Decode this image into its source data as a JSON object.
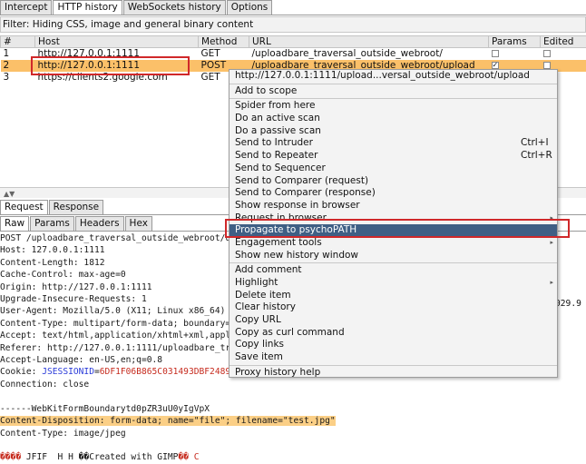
{
  "top_tabs": [
    "Intercept",
    "HTTP history",
    "WebSockets history",
    "Options"
  ],
  "filter_text": "Filter: Hiding CSS, image and general binary content",
  "columns": [
    "#",
    "Host",
    "Method",
    "URL",
    "Params",
    "Edited"
  ],
  "rows": [
    {
      "num": "1",
      "host": "http://127.0.0.1:1111",
      "method": "GET",
      "url": "/uploadbare_traversal_outside_webroot/",
      "params": false
    },
    {
      "num": "2",
      "host": "http://127.0.0.1:1111",
      "method": "POST",
      "url": "/uploadbare_traversal_outside_webroot/upload",
      "params": true
    },
    {
      "num": "3",
      "host": "https://clients2.google.com",
      "method": "GET",
      "url": "",
      "params": false
    }
  ],
  "req_tabs": [
    "Request",
    "Response"
  ],
  "sub_tabs": [
    "Raw",
    "Params",
    "Headers",
    "Hex"
  ],
  "request_lines": [
    "POST /uploadbare_traversal_outside_webroot/u",
    "Host: 127.0.0.1:1111",
    "Content-Length: 1812",
    "Cache-Control: max-age=0",
    "Origin: http://127.0.0.1:1111",
    "Upgrade-Insecure-Requests: 1",
    "User-Agent: Mozilla/5.0 (X11; Linux x86_64)",
    "Content-Type: multipart/form-data; boundary=",
    "Accept: text/html,application/xhtml+xml,appl",
    "Referer: http://127.0.0.1:1111/uploadbare_tr",
    "Accept-Language: en-US,en;q=0.8"
  ],
  "cookie_prefix": "Cookie: ",
  "cookie_name": "JSESSIONID",
  "cookie_eq": "=",
  "cookie_value": "6DF1F06B865C031493DBF2489",
  "connection_line": "Connection: close",
  "boundary_line": "------WebKitFormBoundarytd0pZR3uU0yIgVpX",
  "disposition_line": "Content-Disposition: form-data; name=\"file\"; filename=\"test.jpg\"",
  "content_type_line": "Content-Type: image/jpeg",
  "binary_prefix": "���� ",
  "binary_text": "JFIF  H H ��Created with GIMP",
  "binary_suffix": "�� C",
  "ua_cut_text": "029.9",
  "context_menu": {
    "header": "http://127.0.0.1:1111/upload...versal_outside_webroot/upload",
    "items": [
      {
        "label": "Add to scope",
        "shortcut": "",
        "submenu": false,
        "sep_after": true
      },
      {
        "label": "Spider from here",
        "shortcut": "",
        "submenu": false
      },
      {
        "label": "Do an active scan",
        "shortcut": "",
        "submenu": false
      },
      {
        "label": "Do a passive scan",
        "shortcut": "",
        "submenu": false
      },
      {
        "label": "Send to Intruder",
        "shortcut": "Ctrl+I",
        "submenu": false
      },
      {
        "label": "Send to Repeater",
        "shortcut": "Ctrl+R",
        "submenu": false
      },
      {
        "label": "Send to Sequencer",
        "shortcut": "",
        "submenu": false
      },
      {
        "label": "Send to Comparer (request)",
        "shortcut": "",
        "submenu": false
      },
      {
        "label": "Send to Comparer (response)",
        "shortcut": "",
        "submenu": false
      },
      {
        "label": "Show response in browser",
        "shortcut": "",
        "submenu": false
      },
      {
        "label": "Request in browser",
        "shortcut": "",
        "submenu": true
      },
      {
        "label": "Propagate to psychoPATH",
        "shortcut": "",
        "submenu": false,
        "highlighted": true
      },
      {
        "label": "Engagement tools",
        "shortcut": "",
        "submenu": true
      },
      {
        "label": "Show new history window",
        "shortcut": "",
        "submenu": false,
        "sep_after": true
      },
      {
        "label": "Add comment",
        "shortcut": "",
        "submenu": false
      },
      {
        "label": "Highlight",
        "shortcut": "",
        "submenu": true
      },
      {
        "label": "Delete item",
        "shortcut": "",
        "submenu": false
      },
      {
        "label": "Clear history",
        "shortcut": "",
        "submenu": false
      },
      {
        "label": "Copy URL",
        "shortcut": "",
        "submenu": false
      },
      {
        "label": "Copy as curl command",
        "shortcut": "",
        "submenu": false
      },
      {
        "label": "Copy links",
        "shortcut": "",
        "submenu": false
      },
      {
        "label": "Save item",
        "shortcut": "",
        "submenu": false,
        "sep_after": true
      },
      {
        "label": "Proxy history help",
        "shortcut": "",
        "submenu": false
      }
    ]
  },
  "colors": {
    "selected_row": "#fbc069",
    "menu_highlight": "#3f5f85",
    "annotation_box": "#d0282a",
    "cookie_name": "#2a3bd9",
    "cookie_value": "#c62b1e"
  }
}
